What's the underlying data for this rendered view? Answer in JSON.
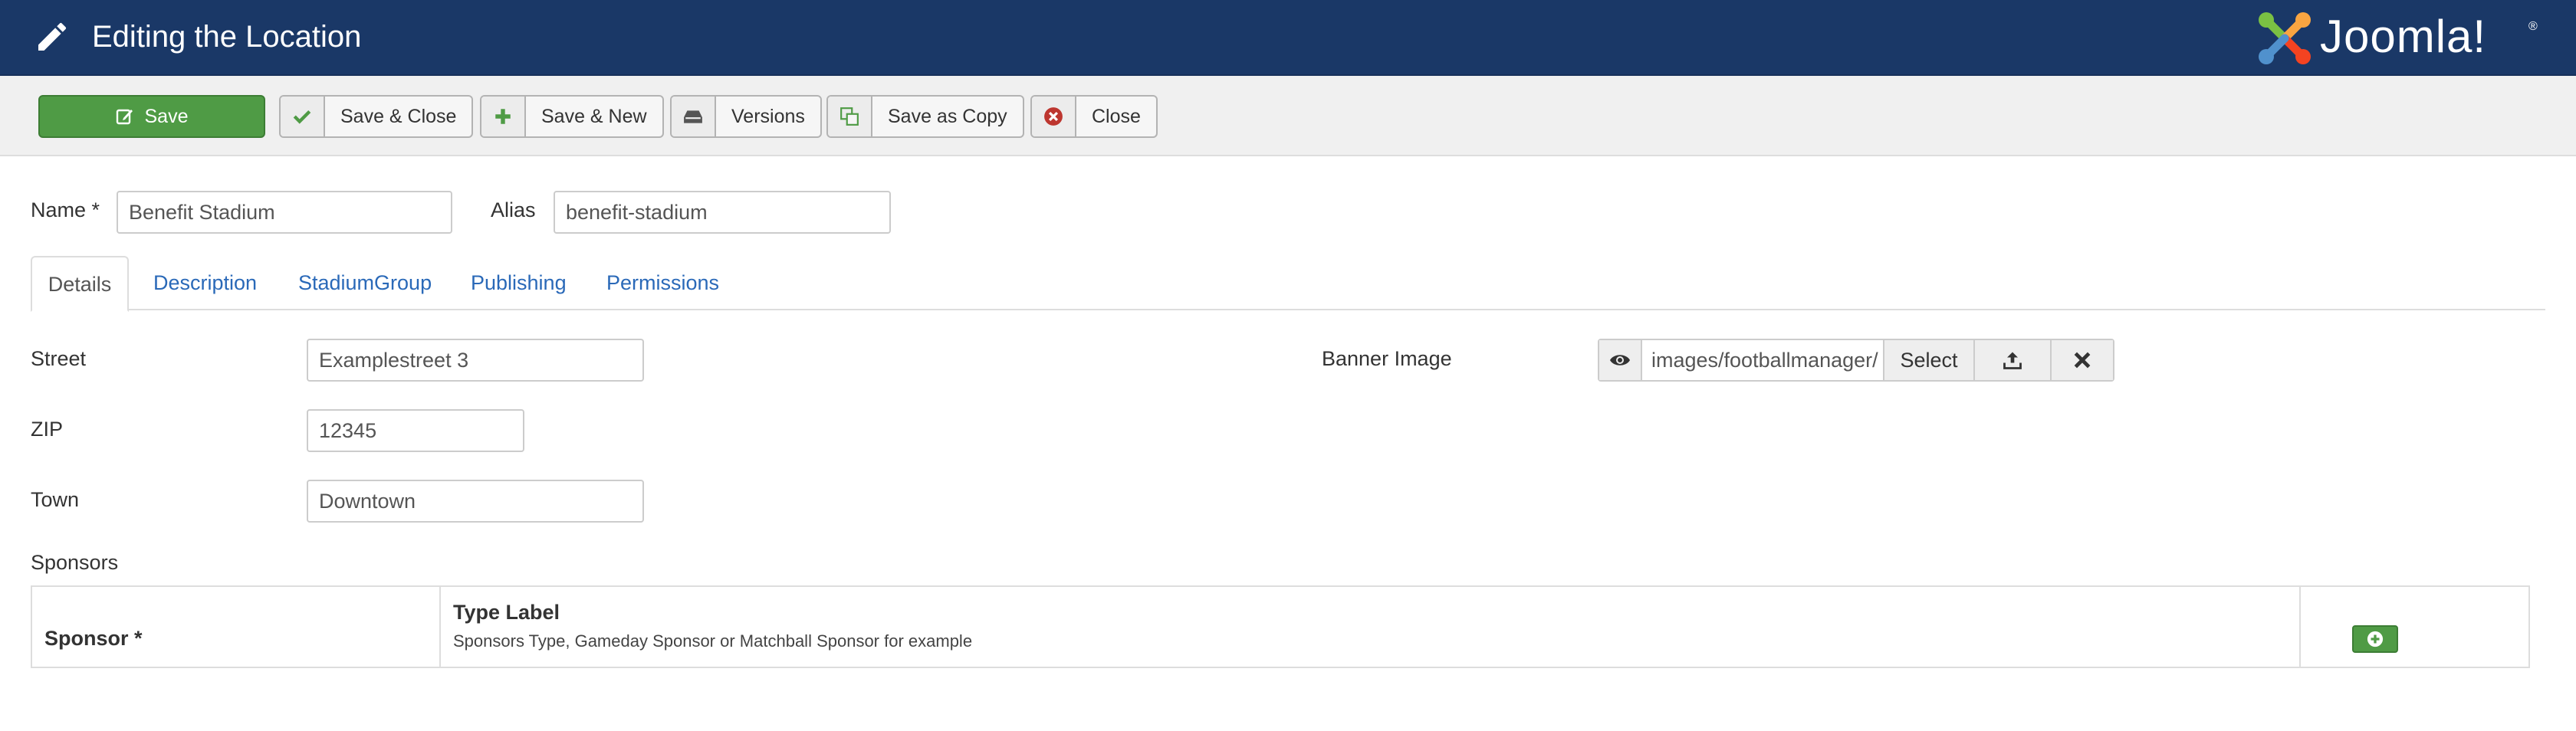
{
  "header": {
    "title": "Editing the Location",
    "logo_text": "Joomla!",
    "logo_mark": "®",
    "bg_color": "#1a3867"
  },
  "toolbar": {
    "save": "Save",
    "save_close": "Save & Close",
    "save_new": "Save & New",
    "versions": "Versions",
    "save_copy": "Save as Copy",
    "close": "Close"
  },
  "form": {
    "name_label": "Name *",
    "name_value": "Benefit Stadium",
    "alias_label": "Alias",
    "alias_value": "benefit-stadium"
  },
  "tabs": [
    "Details",
    "Description",
    "StadiumGroup",
    "Publishing",
    "Permissions"
  ],
  "details": {
    "street_label": "Street",
    "street_value": "Examplestreet 3",
    "zip_label": "ZIP",
    "zip_value": "12345",
    "town_label": "Town",
    "town_value": "Downtown",
    "banner_label": "Banner Image",
    "banner_path": "images/footballmanager/",
    "select_label": "Select"
  },
  "sponsors": {
    "section_label": "Sponsors",
    "col_sponsor": "Sponsor *",
    "col_type": "Type Label",
    "type_desc": "Sponsors Type, Gameday Sponsor or Matchball Sponsor for example"
  },
  "icons": {
    "title": "pencil-icon",
    "save": "edit-icon",
    "save_close": "check-icon",
    "save_new": "plus-icon",
    "versions": "archive-icon",
    "save_copy": "copy-icon",
    "close": "cancel-circle-icon",
    "preview": "eye-icon",
    "upload": "upload-icon",
    "clear": "times-icon",
    "add_row": "plus-circle-icon"
  }
}
